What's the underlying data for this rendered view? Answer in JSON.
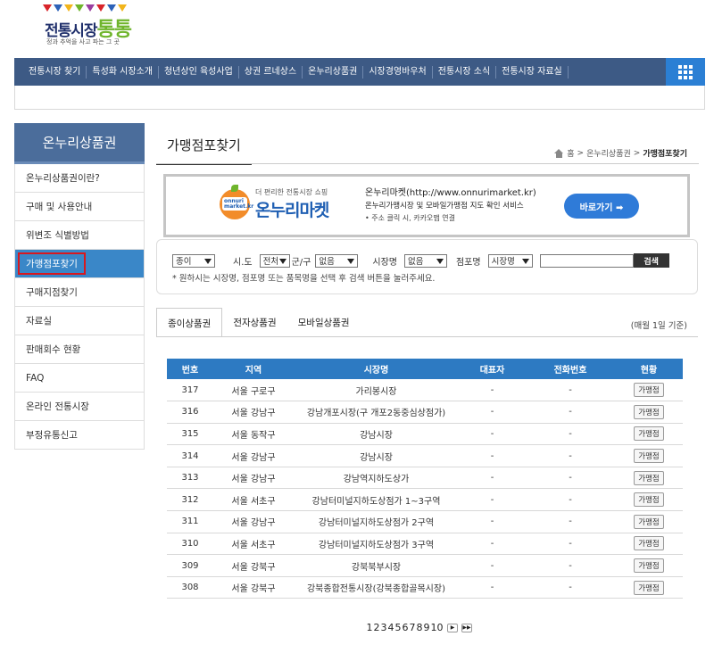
{
  "logo": {
    "title_main": "전통시장",
    "title_accent": "통통",
    "subtitle": "정과 추억을 사고 파는 그 곳",
    "flag_colors": [
      "#d8242a",
      "#2d62b8",
      "#f2b51c",
      "#6fb52c",
      "#9a3ea0",
      "#d8242a",
      "#2d62b8",
      "#f2b51c"
    ]
  },
  "topnav": {
    "items": [
      "전통시장 찾기",
      "특성화 시장소개",
      "청년상인 육성사업",
      "상권 르네상스",
      "온누리상품권",
      "시장경영바우처",
      "전통시장 소식",
      "전통시장 자료실"
    ]
  },
  "sidebar": {
    "heading": "온누리상품권",
    "items": [
      "온누리상품권이란?",
      "구매 및 사용안내",
      "위변조 식별방법",
      "가맹점포찾기",
      "구매지점찾기",
      "자료실",
      "판매회수 현황",
      "FAQ",
      "온라인 전통시장",
      "부정유통신고"
    ],
    "active_index": 3
  },
  "page": {
    "title": "가맹점포찾기",
    "breadcrumb": [
      "홈",
      "온누리상품권",
      "가맹점포찾기"
    ]
  },
  "banner": {
    "small": "더 편리한 전통시장 쇼핑",
    "brand": "온누리마켓",
    "apple_text": "onnuri market.kr",
    "line1": "온누리마켓(http://www.onnurimarket.kr)",
    "line2": "온누리가맹시장 및 모바일가맹점 지도 확인 서비스",
    "line3": "• 주소 클릭 시, 카카오맵 연결",
    "button": "바로가기 ➡"
  },
  "search": {
    "type_value": "종이",
    "sido_label": "시.도",
    "sido_value": "전처",
    "gugun_label": "군/구",
    "gugun_value": "없음",
    "market_label": "시장명",
    "market_value": "없음",
    "store_label": "점포명",
    "store_value": "시장명",
    "input_value": "",
    "button": "검색",
    "note": "* 원하시는 시장명, 점포명 또는 품목명을 선택 후 검색 버튼을 눌러주세요."
  },
  "tabs": {
    "items": [
      "종이상품권",
      "전자상품권",
      "모바일상품권"
    ],
    "active_index": 0,
    "basis": "(매월 1일 기준)"
  },
  "table": {
    "headers": [
      "번호",
      "지역",
      "시장명",
      "대표자",
      "전화번호",
      "현황"
    ],
    "rows": [
      [
        "317",
        "서울 구로구",
        "가리봉시장",
        "-",
        "-",
        "가맹점"
      ],
      [
        "316",
        "서울 강남구",
        "강남개포시장(구 개포2동중심상점가)",
        "-",
        "-",
        "가맹점"
      ],
      [
        "315",
        "서울 동작구",
        "강남시장",
        "-",
        "-",
        "가맹점"
      ],
      [
        "314",
        "서울 강남구",
        "강남시장",
        "-",
        "-",
        "가맹점"
      ],
      [
        "313",
        "서울 강남구",
        "강남역지하도상가",
        "-",
        "-",
        "가맹점"
      ],
      [
        "312",
        "서울 서초구",
        "강남터미널지하도상점가 1~3구역",
        "-",
        "-",
        "가맹점"
      ],
      [
        "311",
        "서울 강남구",
        "강남터미널지하도상점가 2구역",
        "-",
        "-",
        "가맹점"
      ],
      [
        "310",
        "서울 서초구",
        "강남터미널지하도상점가 3구역",
        "-",
        "-",
        "가맹점"
      ],
      [
        "309",
        "서울 강북구",
        "강북북부시장",
        "-",
        "-",
        "가맹점"
      ],
      [
        "308",
        "서울 강북구",
        "강북종합전통시장(강북종합골목시장)",
        "-",
        "-",
        "가맹점"
      ]
    ]
  },
  "pager": {
    "pages": [
      "1",
      "2",
      "3",
      "4",
      "5",
      "6",
      "7",
      "8",
      "9",
      "10"
    ],
    "next": "▶",
    "last": "▶▶"
  },
  "colors": {
    "nav_bg": "#3d5a85",
    "grid_btn": "#2b7fd4",
    "table_head": "#2d7ac2",
    "active_highlight": "#d8181f"
  }
}
